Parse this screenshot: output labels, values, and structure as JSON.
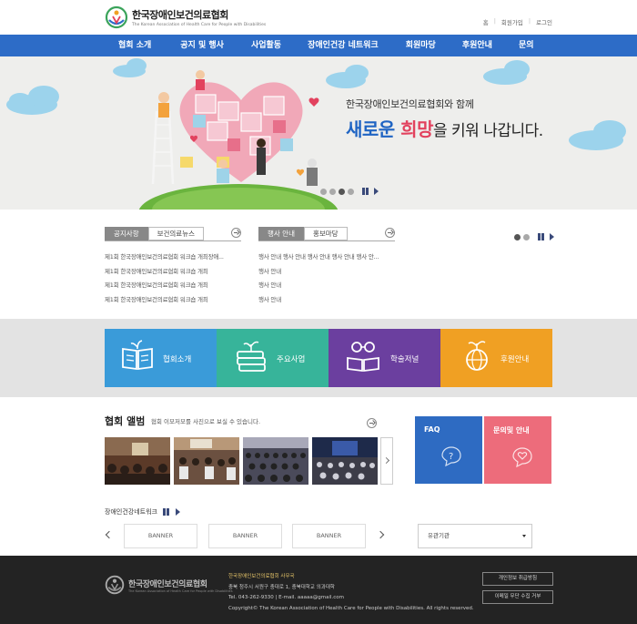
{
  "header": {
    "logo_title": "한국장애인보건의료협회",
    "logo_sub": "The Korean Association of Health Care for People with Disabilities",
    "util": [
      "홈",
      "회원가입",
      "로그인"
    ]
  },
  "nav": [
    "협회 소개",
    "공지 및 행사",
    "사업활동",
    "장애인건강 네트워크",
    "회원마당",
    "후원안내",
    "문의"
  ],
  "hero": {
    "line1": "한국장애인보건의료협회와 함께",
    "line2_a": "새로운 ",
    "line2_b": "희망",
    "line2_c": "을 키워 나갑니다."
  },
  "news_left": {
    "tabs": [
      "공지사항",
      "보건의료뉴스"
    ],
    "items": [
      "제1회 한국장애인보건의료협회 워크숍 개최장애...",
      "제1회 한국장애인보건의료협회 워크숍 개최",
      "제1회 한국장애인보건의료협회 워크숍 개최",
      "제1회 한국장애인보건의료협회 워크숍 개최"
    ]
  },
  "news_right": {
    "tabs": [
      "행사 안내",
      "홍보마당"
    ],
    "items": [
      "행사 안내 행사 안내 행사 안내 행사 안내 행사 안...",
      "행사 안내",
      "행사 안내",
      "행사 안내"
    ]
  },
  "tiles": [
    {
      "label": "협회소개",
      "color": "#3a9bd9",
      "icon": "open-book-icon"
    },
    {
      "label": "주요사업",
      "color": "#37b49a",
      "icon": "books-plant-icon"
    },
    {
      "label": "학술저널",
      "color": "#6b3f9f",
      "icon": "book-glasses-icon"
    },
    {
      "label": "후원안내",
      "color": "#f0a023",
      "icon": "globe-plant-icon"
    }
  ],
  "album": {
    "title": "협회 앨범",
    "sub": "협회 이모저모를 사진으로 보실 수 있습니다."
  },
  "faq_label": "FAQ",
  "inquiry_label": "문의및 안내",
  "network": {
    "title": "장애인건강네트워크",
    "banners": [
      "BANNER",
      "BANNER",
      "BANNER"
    ]
  },
  "related": {
    "selected": "유관기관"
  },
  "footer": {
    "logo_title": "한국장애인보건의료협회",
    "logo_sub": "The Korean Association of Health Care for People with Disabilities",
    "office": "한국장애인보건의료협회 사무국",
    "address": "충북 청주시 서원구 충대로 1, 충북대학교 의과대학",
    "contact": "Tel. 043-262-9330 | E-mail. aaaaa@gmail.com",
    "copyright": "Copyright© The Korean Association of Health Care for People with Disabilities. All rights reserved.",
    "btn_privacy": "개인정보 취급방침",
    "btn_email": "이메일 무단 수집 거부"
  }
}
